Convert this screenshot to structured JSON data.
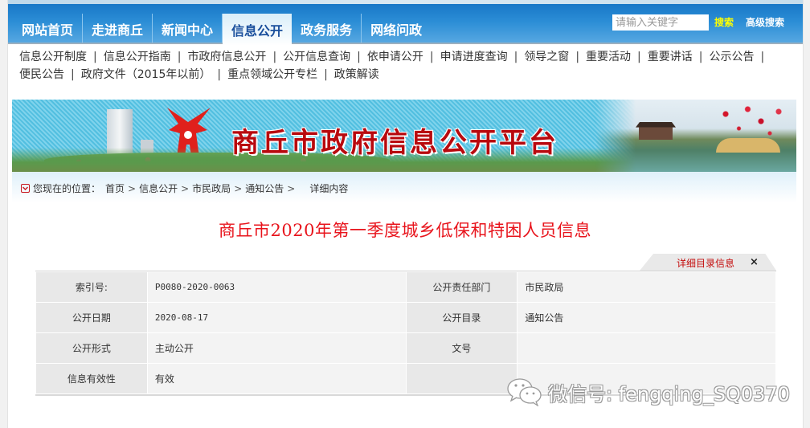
{
  "nav": {
    "tabs": [
      {
        "label": "网站首页",
        "active": false
      },
      {
        "label": "走进商丘",
        "active": false
      },
      {
        "label": "新闻中心",
        "active": false
      },
      {
        "label": "信息公开",
        "active": true
      },
      {
        "label": "政务服务",
        "active": false
      },
      {
        "label": "网络问政",
        "active": false
      }
    ],
    "search_placeholder": "请输入关键字",
    "search_label": "搜索",
    "advanced_search_label": "高级搜索",
    "colors": {
      "bar": "#2c8ed6",
      "search": "#ffff00",
      "active_text": "#1a4f9c"
    }
  },
  "subnav": {
    "row1": [
      "信息公开制度",
      "信息公开指南",
      "市政府信息公开",
      "公开信息查询",
      "依申请公开",
      "申请进度查询",
      "领导之窗",
      "重要活动",
      "重要讲话",
      "公示公告"
    ],
    "row2": [
      "便民公告",
      "政府文件（2015年以前）",
      "重点领域公开专栏",
      "政策解读"
    ],
    "separator": "|"
  },
  "banner": {
    "title": "商丘市政府信息公开平台"
  },
  "breadcrumb": {
    "prefix": "您现在的位置：",
    "items": [
      "首页",
      "信息公开",
      "市民政局",
      "通知公告"
    ],
    "current": "详细内容",
    "separator": ">"
  },
  "article": {
    "title": "商丘市2020年第一季度城乡低保和特困人员信息",
    "title_color": "#e8141c"
  },
  "meta": {
    "tab_label": "详细目录信息",
    "close_label": "×",
    "rows": [
      {
        "k1": "索引号:",
        "v1": "P0080-2020-0063",
        "k2": "公开责任部门",
        "v2": "市民政局"
      },
      {
        "k1": "公开日期",
        "v1": "2020-08-17",
        "k2": "公开目录",
        "v2": "通知公告"
      },
      {
        "k1": "公开形式",
        "v1": "主动公开",
        "k2": "文号",
        "v2": ""
      },
      {
        "k1": "信息有效性",
        "v1": "有效",
        "k2": "",
        "v2": ""
      }
    ]
  },
  "watermark": {
    "text": "微信号: fengqing_SQ0370"
  }
}
